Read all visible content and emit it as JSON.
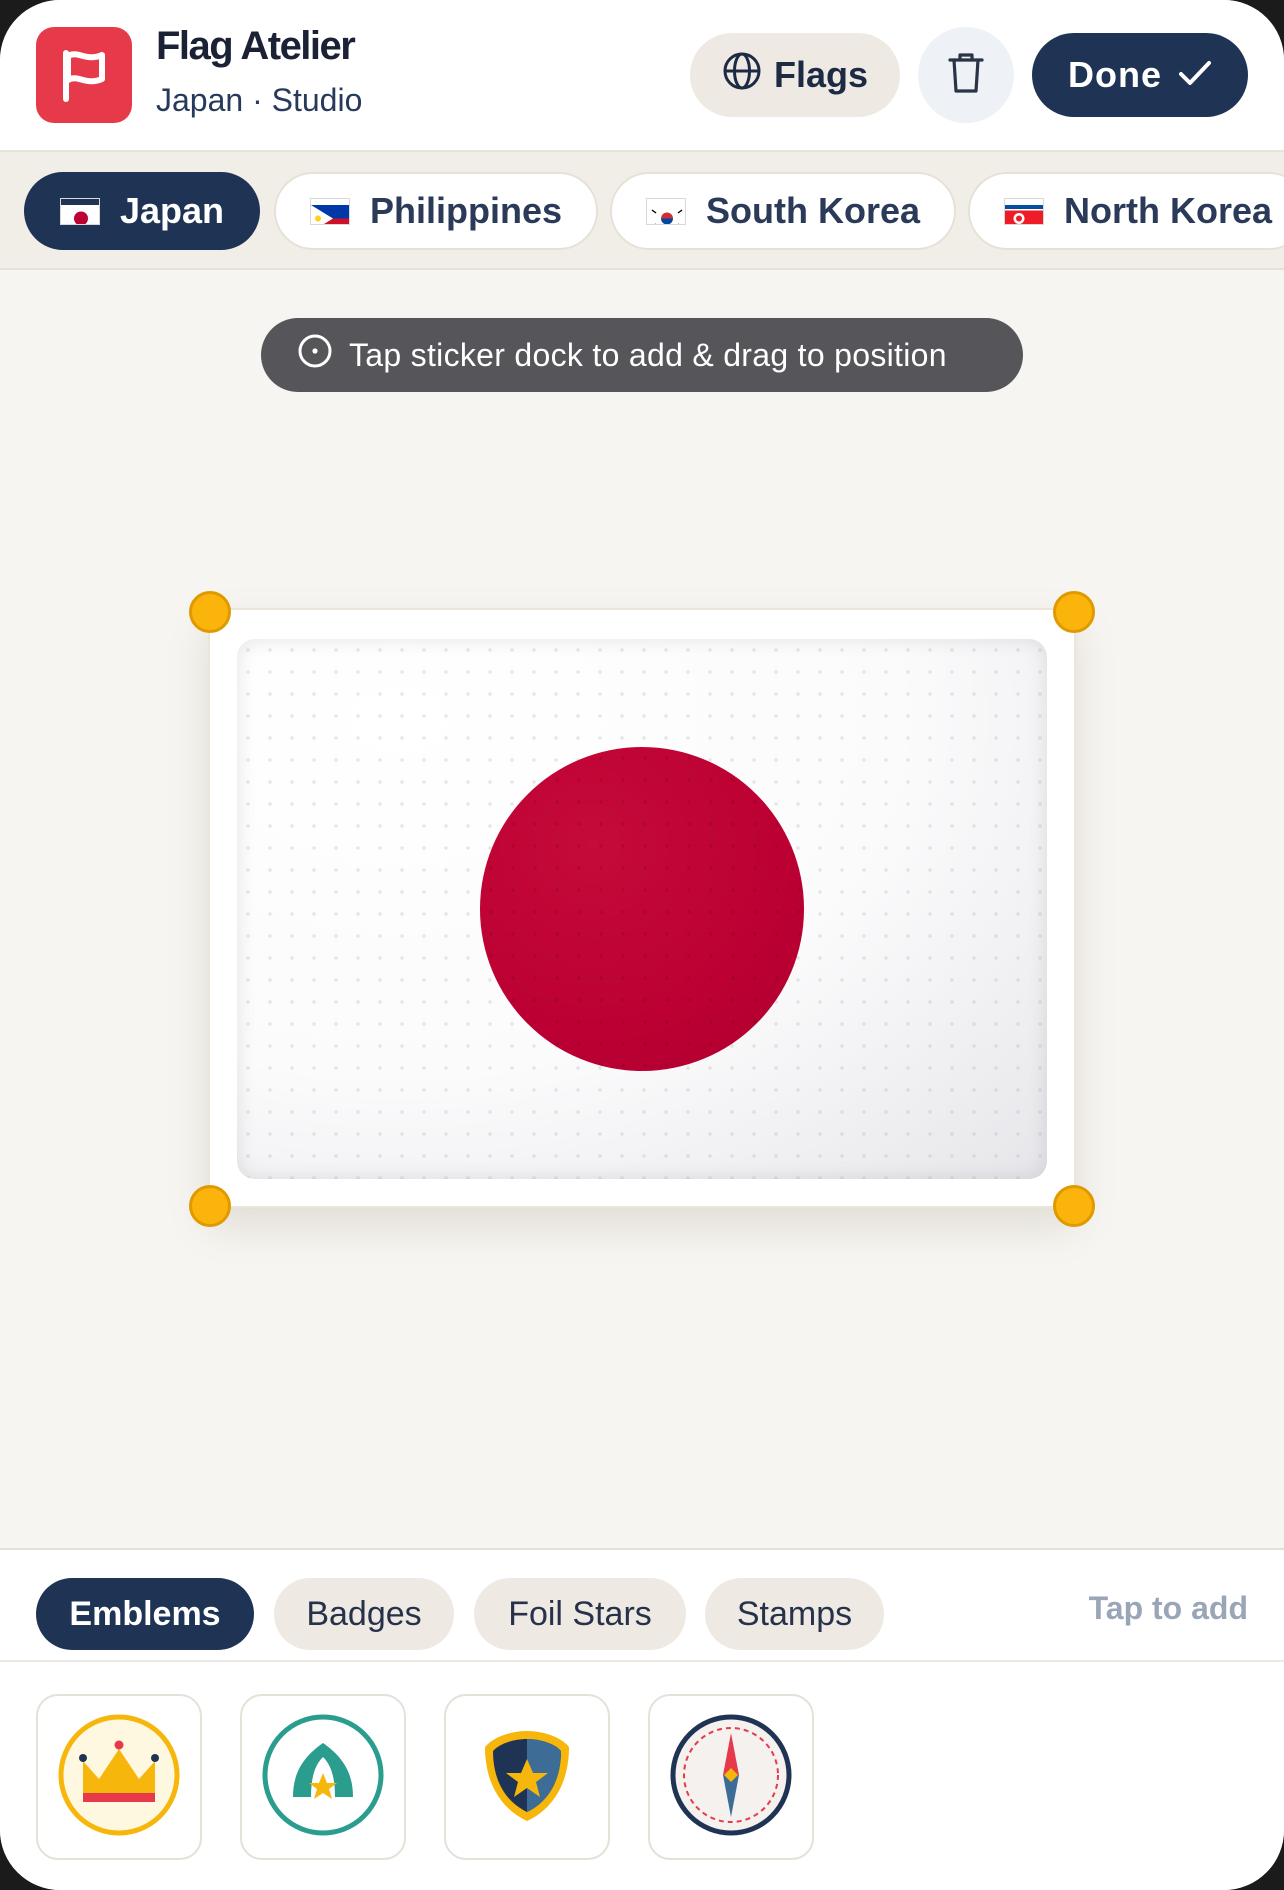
{
  "header": {
    "title": "Flag Atelier",
    "subtitle": "Japan · Studio",
    "flags_label": "Flags",
    "done_label": "Done",
    "icons": [
      "flag-icon",
      "globe-icon",
      "trash-icon",
      "check-icon"
    ]
  },
  "country_tabs": [
    {
      "label": "Japan",
      "active": true
    },
    {
      "label": "Philippines",
      "active": false
    },
    {
      "label": "South Korea",
      "active": false
    },
    {
      "label": "North Korea",
      "active": false
    }
  ],
  "hint": {
    "text": "Tap sticker dock to add & drag to position",
    "icon": "info-icon"
  },
  "canvas": {
    "flag": "Japan",
    "colors": {
      "disc": "#bc0033",
      "field": "#ffffff",
      "handles": "#fbb40c"
    }
  },
  "dock": {
    "categories": [
      {
        "label": "Emblems",
        "active": true
      },
      {
        "label": "Badges",
        "active": false
      },
      {
        "label": "Foil Stars",
        "active": false
      },
      {
        "label": "Stamps",
        "active": false
      }
    ],
    "hint": "Tap to add",
    "stickers": [
      "crown-sticker",
      "leaf-star-sticker",
      "shield-star-sticker",
      "compass-sticker"
    ]
  },
  "colors": {
    "navy": "#1f3354",
    "accent": "#e63a4b",
    "background": "#f7f5f1"
  }
}
